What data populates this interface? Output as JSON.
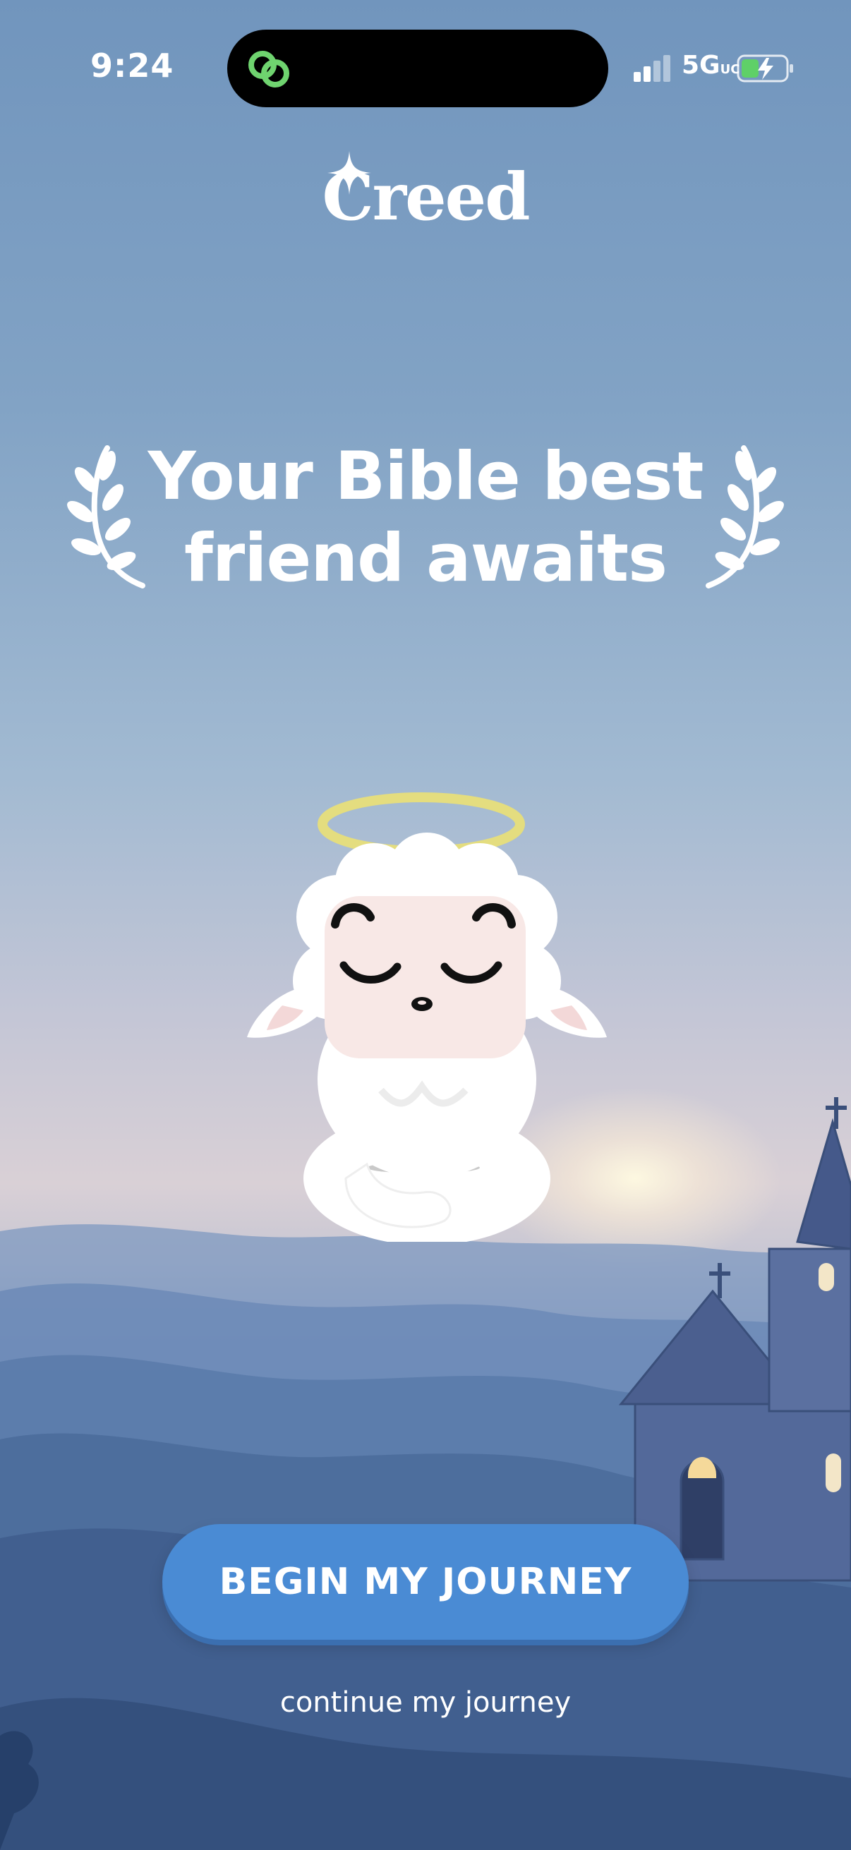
{
  "status_bar": {
    "time": "9:24",
    "network": "5G",
    "network_suffix": "UC"
  },
  "brand": {
    "name": "Creed"
  },
  "headline": {
    "line1": "Your Bible best",
    "line2": "friend awaits"
  },
  "actions": {
    "primary_label": "BEGIN MY JOURNEY",
    "secondary_label": "continue my journey"
  },
  "colors": {
    "primary_button": "#4a8bd4",
    "halo": "#e7de7a",
    "sky_top": "#7195bd",
    "hills": "#3d5a88"
  },
  "icons": [
    "link-icon",
    "signal-icon",
    "battery-charging-icon",
    "sparkle-icon",
    "laurel-icon",
    "praying-lamb-mascot",
    "church-illustration"
  ]
}
